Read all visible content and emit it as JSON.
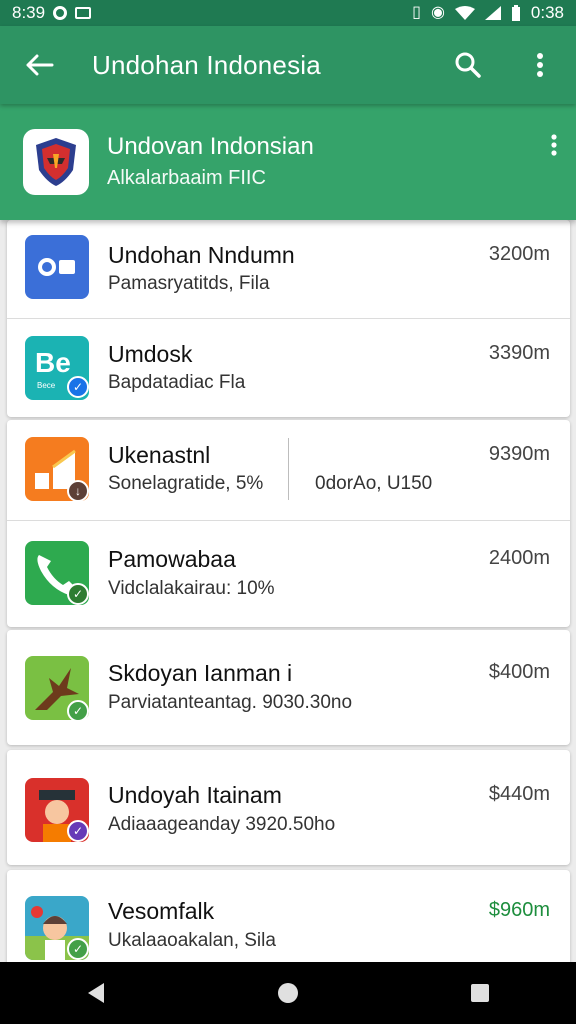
{
  "status_bar": {
    "time_left": "8:39",
    "time_right": "0:38",
    "left_icons": [
      "record-icon",
      "photo-icon"
    ],
    "right_icons": [
      "vibrate-icon",
      "hotspot-icon",
      "wifi-icon",
      "signal-icon",
      "battery-icon"
    ]
  },
  "app_bar": {
    "title": "Undohan Indonesia",
    "back_icon": "back-arrow-icon",
    "search_icon": "search-icon",
    "more_icon": "more-vert-icon"
  },
  "header": {
    "title": "Undovan Indonsian",
    "subtitle": "Alkalarbaaim FIIC"
  },
  "items": [
    {
      "name": "Undohan Nndumn",
      "sub": "Pamasryatitds, Fila",
      "price": "3200m",
      "icon": "game-controller-icon",
      "color": "#3b6fd8"
    },
    {
      "name": "Umdosk",
      "sub": "Bapdatadiac Fla",
      "price": "3390m",
      "icon": "be-letters-icon",
      "color": "#1bb3b3"
    },
    {
      "name": "Ukenastnl",
      "sub": "Sonelagratide, 5%",
      "extra": "0dorAo, U150",
      "price": "9390m",
      "icon": "chart-icon",
      "color": "#f57c1f"
    },
    {
      "name": "Pamowabaa",
      "sub": "Vidclalakairau: 10%",
      "price": "2400m",
      "icon": "phone-icon",
      "color": "#2eaa4f"
    },
    {
      "name": "Skdoyan Ianman  i",
      "sub": "Parviatanteantag. 9030.30no",
      "price": "$400m",
      "icon": "lizard-icon",
      "color": "#7ac043"
    },
    {
      "name": "Undoyah Itainam",
      "sub": "Adiaaageanday  3920.50ho",
      "price": "$440m",
      "icon": "character-icon",
      "color": "#d9302b"
    },
    {
      "name": "Vesomfalk",
      "sub": "Ukalaaoakalan, Sila",
      "price": "$960m",
      "icon": "kid-icon",
      "color": "#3aa7c9",
      "price_color": "#1e8e3e"
    }
  ],
  "nav_bar": {
    "back": "nav-back-icon",
    "home": "nav-home-icon",
    "recents": "nav-recents-icon"
  }
}
